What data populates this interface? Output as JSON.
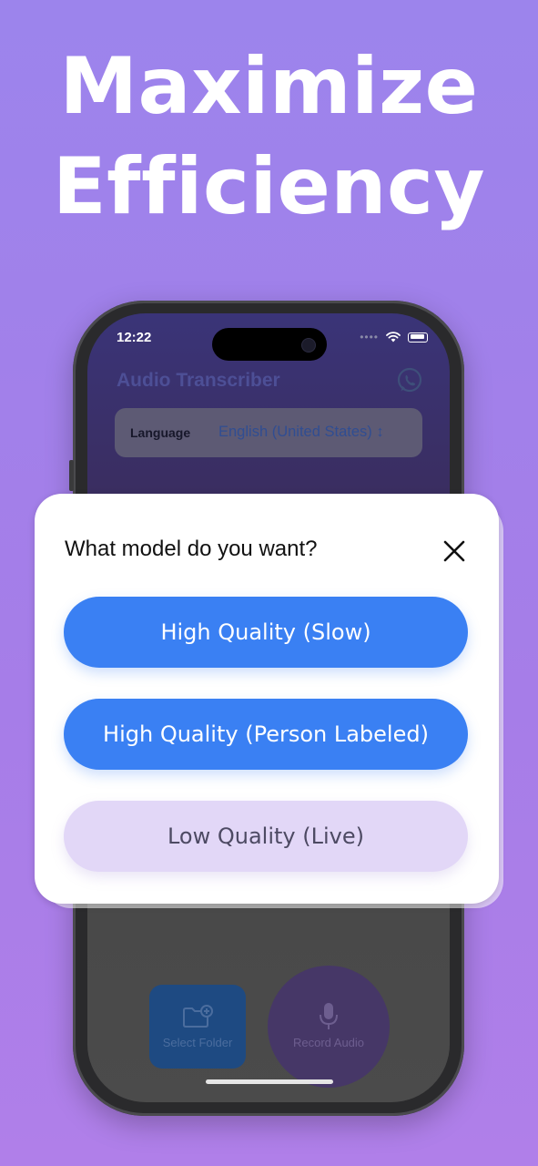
{
  "headline": {
    "line1": "Maximize",
    "line2": "Efficiency"
  },
  "status_bar": {
    "time": "12:22"
  },
  "app": {
    "title": "Audio Transcriber",
    "language_label": "Language",
    "language_value": "English (United States) ↕"
  },
  "bottom_actions": {
    "select_folder": "Select Folder",
    "record_audio": "Record Audio"
  },
  "modal": {
    "title": "What model do you want?",
    "options": [
      {
        "label": "High Quality (Slow)"
      },
      {
        "label": "High Quality (Person Labeled)"
      },
      {
        "label": "Low Quality (Live)"
      }
    ]
  },
  "colors": {
    "background_top": "#9c84ec",
    "background_bottom": "#b07fe9",
    "primary_button": "#3a80f3",
    "secondary_button": "#e2d7f7"
  }
}
